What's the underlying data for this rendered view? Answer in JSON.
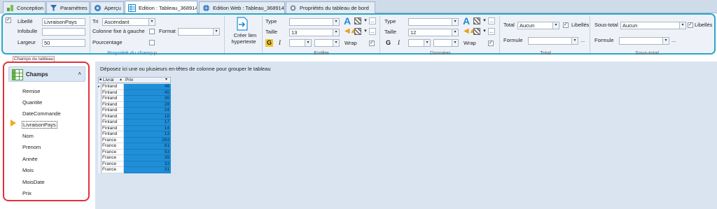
{
  "tabs": [
    {
      "label": "Conception",
      "icon": "conception-icon",
      "active": false
    },
    {
      "label": "Paramètres",
      "icon": "filter-icon",
      "active": false
    },
    {
      "label": "Aperçu",
      "icon": "preview-icon",
      "active": false
    },
    {
      "label": "Edition : Tableau_368914",
      "icon": "table-icon",
      "active": true
    },
    {
      "label": "Edition Web : Tableau_368914",
      "icon": "web-icon",
      "active": false
    },
    {
      "label": "Propriétés du tableau de bord",
      "icon": "settings-icon",
      "active": false
    }
  ],
  "ribbon": {
    "champ": {
      "libelle_label": "Libellé",
      "libelle_value": "LivraisonPays",
      "infobulle_label": "Infobulle",
      "infobulle_value": "",
      "largeur_label": "Largeur",
      "largeur_value": "50",
      "group_label": "Propriété du champ",
      "group_suffix": "p",
      "header_checked": true
    },
    "tri": {
      "tri_label": "Tri",
      "tri_value": "Ascendant",
      "colonne_fixe_label": "Colonne fixe à gauche",
      "colonne_fixe_checked": false,
      "pourcentage_label": "Pourcentage",
      "pourcentage_checked": false,
      "format_label": "Format",
      "format_value": ""
    },
    "lien": {
      "label_line1": "Créer lien",
      "label_line2": "hypertexte"
    },
    "entete": {
      "type_label": "Type",
      "type_value": "",
      "taille_label": "Taille",
      "taille_value": "13",
      "wrap_label": "Wrap",
      "wrap_checked": true,
      "group_label": "Entête",
      "bold_glyph": "G",
      "italic_glyph": "I",
      "font_glyph": "A"
    },
    "donnees": {
      "type_label": "Type",
      "type_value": "",
      "taille_label": "Taille",
      "taille_value": "12",
      "wrap_label": "Wrap",
      "wrap_checked": true,
      "group_label": "Données",
      "bold_glyph": "G",
      "italic_glyph": "I",
      "font_glyph": "A"
    },
    "total": {
      "total_label": "Total",
      "total_value": "Aucun",
      "libelles_label": "Libellés",
      "libelles_checked": true,
      "formule_label": "Formule",
      "formule_value": "",
      "group_label": "Total",
      "dots": "..."
    },
    "soustotal": {
      "soustotal_label": "Sous-total",
      "soustotal_value": "Aucun",
      "libelles_label": "Libellés",
      "libelles_checked": true,
      "formule_label": "Formule",
      "formule_value": "",
      "group_label": "Sous-total",
      "dots": "..."
    },
    "dots": "..."
  },
  "hint_tag": "Champs du tableau",
  "fields_panel": {
    "title": "Champs",
    "items": [
      "Remise",
      "Quantite",
      "DateCommande",
      "LivraisonPays",
      "Nom",
      "Prenom",
      "Année",
      "Mois",
      "MoisDate",
      "Prix"
    ],
    "selected_index": 3
  },
  "grid": {
    "group_hint": "Déposez ici une ou plusieurs en-têtes de colonne pour grouper le tableau",
    "columns": [
      "Livrai",
      "Prix"
    ],
    "rows": [
      {
        "livraison": "Finland",
        "prix": "46"
      },
      {
        "livraison": "Finland",
        "prix": "45"
      },
      {
        "livraison": "Finland",
        "prix": "36"
      },
      {
        "livraison": "Finland",
        "prix": "28"
      },
      {
        "livraison": "Finland",
        "prix": "24"
      },
      {
        "livraison": "Finland",
        "prix": "18"
      },
      {
        "livraison": "Finland",
        "prix": "17"
      },
      {
        "livraison": "Finland",
        "prix": "14"
      },
      {
        "livraison": "Finland",
        "prix": "13"
      },
      {
        "livraison": "France",
        "prix": "263"
      },
      {
        "livraison": "France",
        "prix": "81"
      },
      {
        "livraison": "France",
        "prix": "53"
      },
      {
        "livraison": "France",
        "prix": "39"
      },
      {
        "livraison": "France",
        "prix": "33"
      },
      {
        "livraison": "France",
        "prix": "31"
      }
    ]
  },
  "colors": {
    "accent": "#2aa6c8",
    "highlight_border": "#e0323c",
    "selected_cell": "#1f8fd8"
  }
}
